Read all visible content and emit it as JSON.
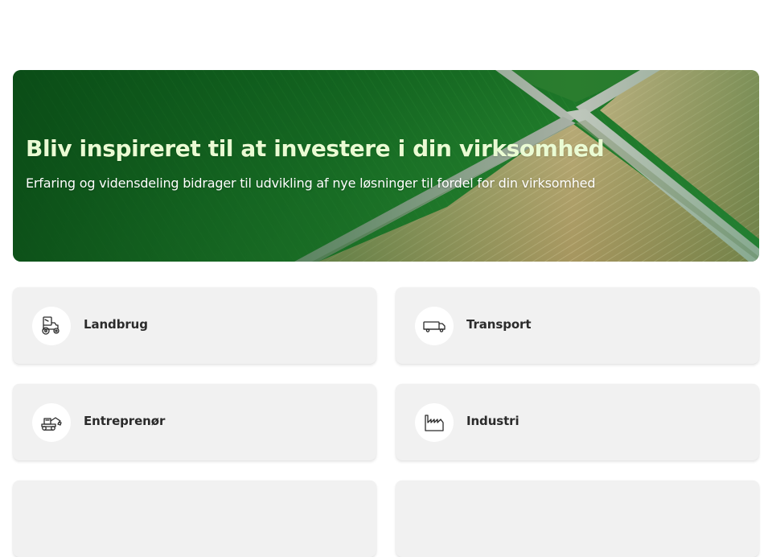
{
  "hero": {
    "title": "Bliv inspireret til at investere i din virksomhed",
    "subtitle": "Erfaring og vidensdeling bidrager til udvikling af nye løsninger til fordel for din virksomhed"
  },
  "categories": [
    {
      "label": "Landbrug",
      "icon": "tractor-icon"
    },
    {
      "label": "Transport",
      "icon": "truck-icon"
    },
    {
      "label": "Entreprenør",
      "icon": "excavator-icon"
    },
    {
      "label": "Industri",
      "icon": "factory-icon"
    }
  ],
  "colors": {
    "hero_title": "#eafbd3",
    "card_background": "#f1f1f1",
    "field_green": "#1f7a2a"
  }
}
